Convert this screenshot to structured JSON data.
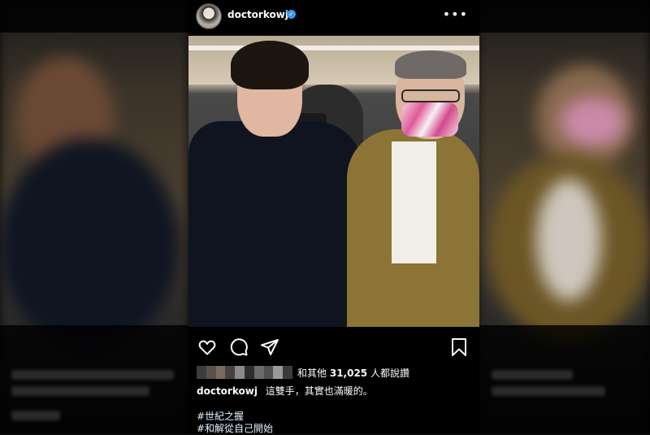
{
  "post": {
    "username": "doctorkowj",
    "verified": true,
    "more_icon": "more-horizontal-icon",
    "icons": [
      "heart-icon",
      "comment-icon",
      "share-icon",
      "bookmark-icon"
    ],
    "likes": {
      "prefix": "和其他",
      "count": "31,025",
      "suffix": "人都說讚"
    },
    "caption": {
      "username": "doctorkowj",
      "text": "這雙手，其實也滿暖的。"
    },
    "hashtags": [
      "#世紀之握",
      "#和解從自己開始"
    ]
  },
  "colors": {
    "background": "#000000",
    "text": "#fafafa",
    "verified": "#3897f0",
    "hashtag": "#e0f1ff"
  }
}
